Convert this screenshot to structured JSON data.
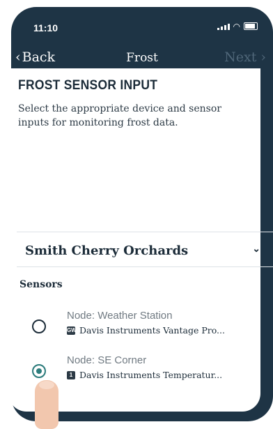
{
  "status": {
    "time": "11:10"
  },
  "nav": {
    "back_label": "Back",
    "title": "Frost",
    "next_label": "Next"
  },
  "form": {
    "heading": "FROST SENSOR INPUT",
    "description": "Select the appropriate device and sensor inputs for monitoring frost data.",
    "orchard_selected": "Smith Cherry Orchards",
    "sensors_label": "Sensors"
  },
  "sensors": [
    {
      "title": "Node: Weather Station",
      "badge": "GW",
      "device": "Davis Instruments Vantage Pro...",
      "selected": false
    },
    {
      "title": "Node: SE Corner",
      "badge": "1",
      "device": "Davis Instruments Temperatur...",
      "selected": true
    }
  ],
  "icons": {
    "back": "chevron-left-icon",
    "next": "chevron-right-icon",
    "dropdown": "chevron-down-icon"
  },
  "colors": {
    "phone_frame": "#1e3445",
    "accent_selected": "#2e7d7d",
    "disabled_nav": "#4f6678"
  }
}
